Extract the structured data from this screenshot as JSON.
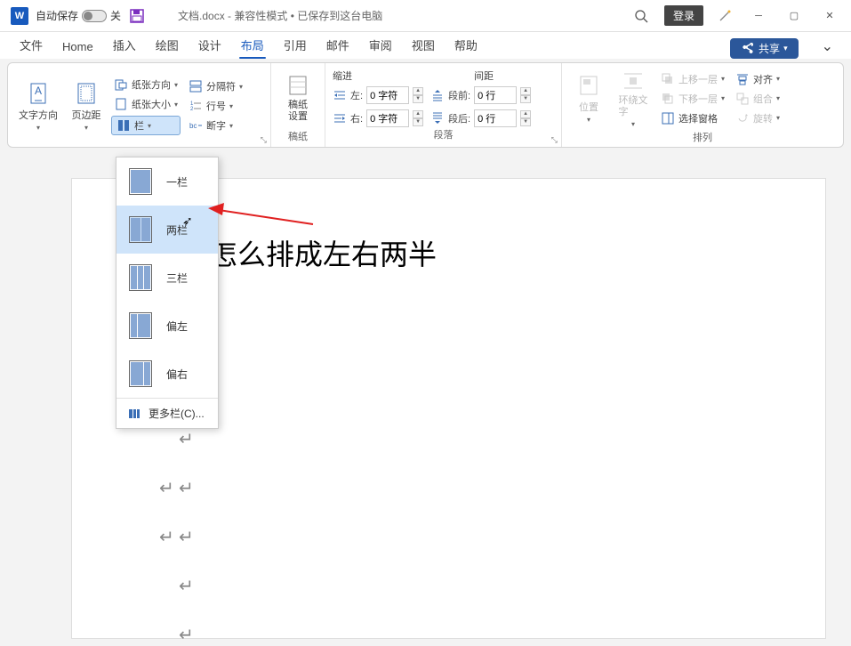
{
  "titlebar": {
    "autosave_label": "自动保存",
    "autosave_state": "关",
    "doc_title": "文档.docx  -  兼容性模式 • 已保存到这台电脑",
    "login_button": "登录"
  },
  "tabs": {
    "file": "文件",
    "home": "Home",
    "insert": "插入",
    "draw": "绘图",
    "design": "设计",
    "layout": "布局",
    "references": "引用",
    "mail": "邮件",
    "review": "审阅",
    "view": "视图",
    "help": "帮助",
    "share": "共享"
  },
  "ribbon": {
    "text_direction": "文字方向",
    "margins": "页边距",
    "orientation": "纸张方向",
    "size": "纸张大小",
    "columns": "栏",
    "breaks": "分隔符",
    "line_numbers": "行号",
    "hyphenation": "断字",
    "manuscript_label": "稿纸\n设置",
    "manuscript_group": "稿纸",
    "paragraph_group": "段落",
    "indent_header": "缩进",
    "spacing_header": "间距",
    "indent_left_label": "左:",
    "indent_right_label": "右:",
    "indent_value": "0 字符",
    "space_before_label": "段前:",
    "space_after_label": "段后:",
    "space_value": "0 行",
    "position": "位置",
    "wrap_text": "环绕文\n字",
    "bring_forward": "上移一层",
    "send_backward": "下移一层",
    "selection_pane": "选择窗格",
    "align": "对齐",
    "group": "组合",
    "rotate": "旋转",
    "arrange_group": "排列"
  },
  "columns_menu": {
    "one": "一栏",
    "two": "两栏",
    "three": "三栏",
    "left": "偏左",
    "right": "偏右",
    "more": "更多栏(C)..."
  },
  "document": {
    "heading_visible": "d 怎么排成左右两半"
  }
}
